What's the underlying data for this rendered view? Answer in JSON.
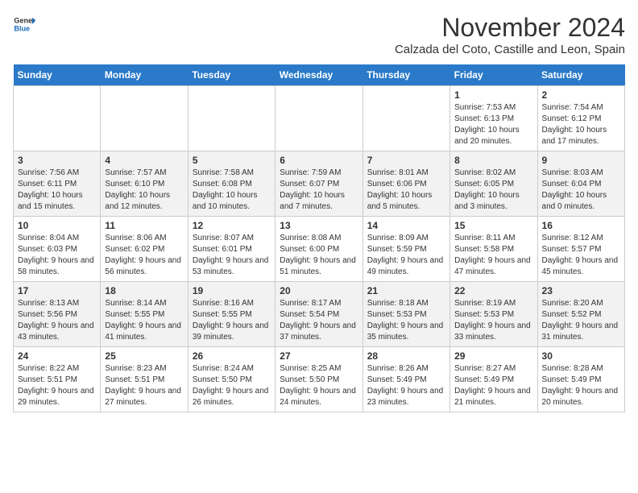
{
  "header": {
    "logo_line1": "General",
    "logo_line2": "Blue",
    "month": "November 2024",
    "location": "Calzada del Coto, Castille and Leon, Spain"
  },
  "weekdays": [
    "Sunday",
    "Monday",
    "Tuesday",
    "Wednesday",
    "Thursday",
    "Friday",
    "Saturday"
  ],
  "weeks": [
    [
      {
        "day": "",
        "info": ""
      },
      {
        "day": "",
        "info": ""
      },
      {
        "day": "",
        "info": ""
      },
      {
        "day": "",
        "info": ""
      },
      {
        "day": "",
        "info": ""
      },
      {
        "day": "1",
        "info": "Sunrise: 7:53 AM\nSunset: 6:13 PM\nDaylight: 10 hours and 20 minutes."
      },
      {
        "day": "2",
        "info": "Sunrise: 7:54 AM\nSunset: 6:12 PM\nDaylight: 10 hours and 17 minutes."
      }
    ],
    [
      {
        "day": "3",
        "info": "Sunrise: 7:56 AM\nSunset: 6:11 PM\nDaylight: 10 hours and 15 minutes."
      },
      {
        "day": "4",
        "info": "Sunrise: 7:57 AM\nSunset: 6:10 PM\nDaylight: 10 hours and 12 minutes."
      },
      {
        "day": "5",
        "info": "Sunrise: 7:58 AM\nSunset: 6:08 PM\nDaylight: 10 hours and 10 minutes."
      },
      {
        "day": "6",
        "info": "Sunrise: 7:59 AM\nSunset: 6:07 PM\nDaylight: 10 hours and 7 minutes."
      },
      {
        "day": "7",
        "info": "Sunrise: 8:01 AM\nSunset: 6:06 PM\nDaylight: 10 hours and 5 minutes."
      },
      {
        "day": "8",
        "info": "Sunrise: 8:02 AM\nSunset: 6:05 PM\nDaylight: 10 hours and 3 minutes."
      },
      {
        "day": "9",
        "info": "Sunrise: 8:03 AM\nSunset: 6:04 PM\nDaylight: 10 hours and 0 minutes."
      }
    ],
    [
      {
        "day": "10",
        "info": "Sunrise: 8:04 AM\nSunset: 6:03 PM\nDaylight: 9 hours and 58 minutes."
      },
      {
        "day": "11",
        "info": "Sunrise: 8:06 AM\nSunset: 6:02 PM\nDaylight: 9 hours and 56 minutes."
      },
      {
        "day": "12",
        "info": "Sunrise: 8:07 AM\nSunset: 6:01 PM\nDaylight: 9 hours and 53 minutes."
      },
      {
        "day": "13",
        "info": "Sunrise: 8:08 AM\nSunset: 6:00 PM\nDaylight: 9 hours and 51 minutes."
      },
      {
        "day": "14",
        "info": "Sunrise: 8:09 AM\nSunset: 5:59 PM\nDaylight: 9 hours and 49 minutes."
      },
      {
        "day": "15",
        "info": "Sunrise: 8:11 AM\nSunset: 5:58 PM\nDaylight: 9 hours and 47 minutes."
      },
      {
        "day": "16",
        "info": "Sunrise: 8:12 AM\nSunset: 5:57 PM\nDaylight: 9 hours and 45 minutes."
      }
    ],
    [
      {
        "day": "17",
        "info": "Sunrise: 8:13 AM\nSunset: 5:56 PM\nDaylight: 9 hours and 43 minutes."
      },
      {
        "day": "18",
        "info": "Sunrise: 8:14 AM\nSunset: 5:55 PM\nDaylight: 9 hours and 41 minutes."
      },
      {
        "day": "19",
        "info": "Sunrise: 8:16 AM\nSunset: 5:55 PM\nDaylight: 9 hours and 39 minutes."
      },
      {
        "day": "20",
        "info": "Sunrise: 8:17 AM\nSunset: 5:54 PM\nDaylight: 9 hours and 37 minutes."
      },
      {
        "day": "21",
        "info": "Sunrise: 8:18 AM\nSunset: 5:53 PM\nDaylight: 9 hours and 35 minutes."
      },
      {
        "day": "22",
        "info": "Sunrise: 8:19 AM\nSunset: 5:53 PM\nDaylight: 9 hours and 33 minutes."
      },
      {
        "day": "23",
        "info": "Sunrise: 8:20 AM\nSunset: 5:52 PM\nDaylight: 9 hours and 31 minutes."
      }
    ],
    [
      {
        "day": "24",
        "info": "Sunrise: 8:22 AM\nSunset: 5:51 PM\nDaylight: 9 hours and 29 minutes."
      },
      {
        "day": "25",
        "info": "Sunrise: 8:23 AM\nSunset: 5:51 PM\nDaylight: 9 hours and 27 minutes."
      },
      {
        "day": "26",
        "info": "Sunrise: 8:24 AM\nSunset: 5:50 PM\nDaylight: 9 hours and 26 minutes."
      },
      {
        "day": "27",
        "info": "Sunrise: 8:25 AM\nSunset: 5:50 PM\nDaylight: 9 hours and 24 minutes."
      },
      {
        "day": "28",
        "info": "Sunrise: 8:26 AM\nSunset: 5:49 PM\nDaylight: 9 hours and 23 minutes."
      },
      {
        "day": "29",
        "info": "Sunrise: 8:27 AM\nSunset: 5:49 PM\nDaylight: 9 hours and 21 minutes."
      },
      {
        "day": "30",
        "info": "Sunrise: 8:28 AM\nSunset: 5:49 PM\nDaylight: 9 hours and 20 minutes."
      }
    ]
  ]
}
